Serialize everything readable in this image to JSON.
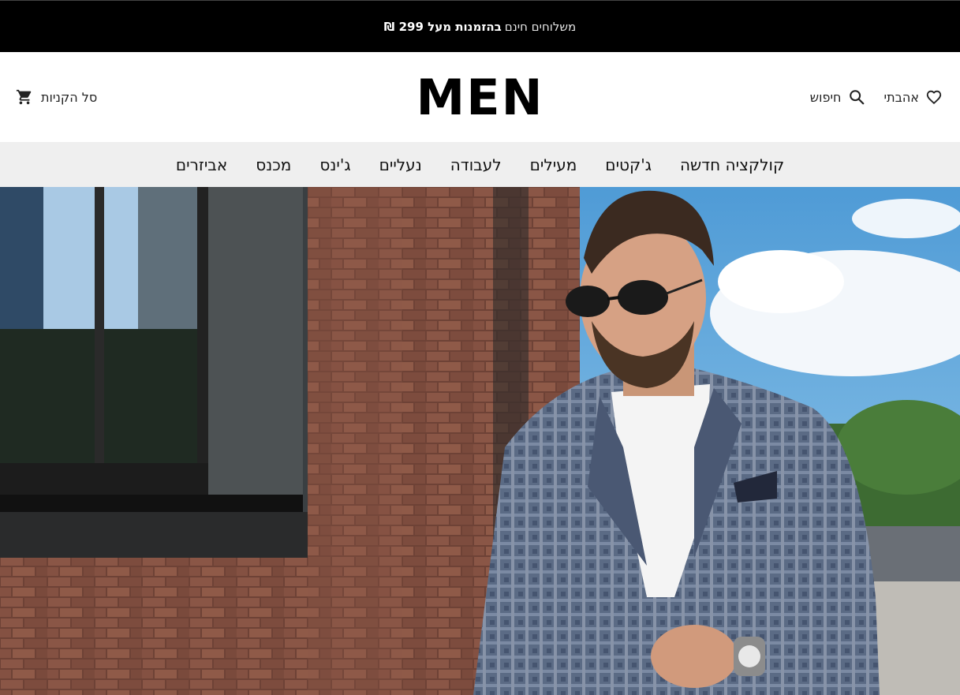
{
  "promo": {
    "text_light": "משלוחים חינם",
    "text_bold": "בהזמנות מעל 299 ₪"
  },
  "header": {
    "logo": "MEN",
    "cart_label": "סל הקניות",
    "search_label": "חיפוש",
    "favorites_label": "אהבתי"
  },
  "nav": {
    "items": [
      {
        "label": "קולקציה חדשה"
      },
      {
        "label": "ג'קטים"
      },
      {
        "label": "מעילים"
      },
      {
        "label": "לעבודה"
      },
      {
        "label": "נעליים"
      },
      {
        "label": "ג'ינס"
      },
      {
        "label": "מכנס"
      },
      {
        "label": "אביזרים"
      }
    ]
  },
  "icons": {
    "cart": "cart-icon",
    "search": "search-icon",
    "favorites": "heart-icon"
  },
  "colors": {
    "promo_bg": "#000000",
    "nav_bg": "#efefef",
    "brick": "#7a4a3c",
    "sky": "#5ea4d8"
  }
}
